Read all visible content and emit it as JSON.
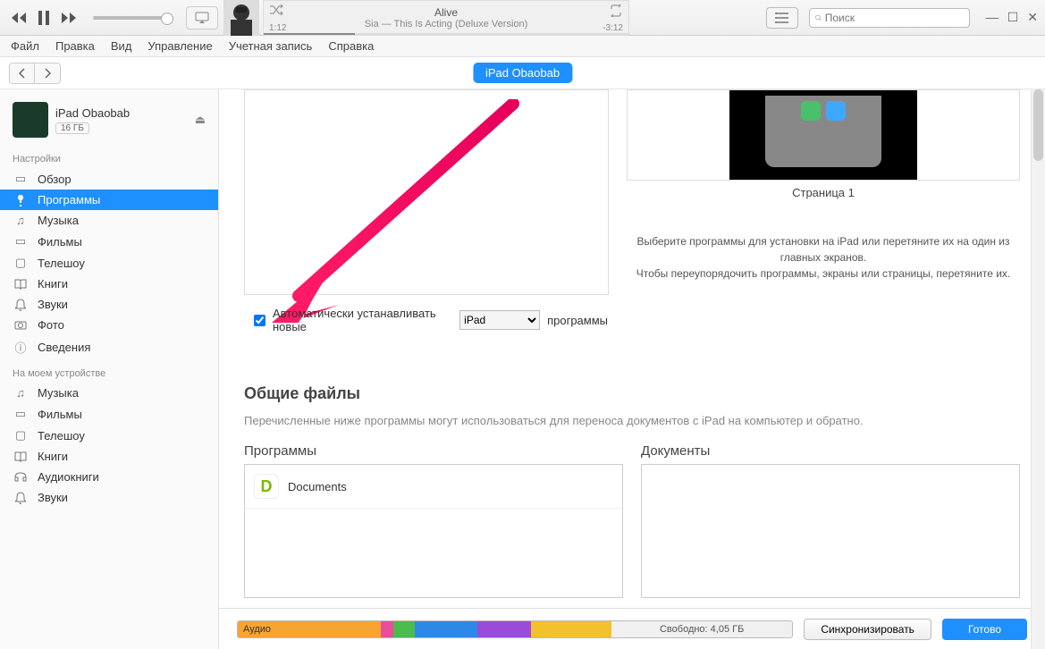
{
  "player": {
    "track_title": "Alive",
    "track_subtitle": "Sia — This Is Acting (Deluxe Version)",
    "time_elapsed": "1:12",
    "time_remaining": "-3:12"
  },
  "search": {
    "placeholder": "Поиск"
  },
  "menubar": [
    "Файл",
    "Правка",
    "Вид",
    "Управление",
    "Учетная запись",
    "Справка"
  ],
  "nav": {
    "device_pill": "iPad Obaobab"
  },
  "device": {
    "name": "iPad Obaobab",
    "capacity": "16 ГБ"
  },
  "sidebar": {
    "section1_label": "Настройки",
    "section1_items": [
      "Обзор",
      "Программы",
      "Музыка",
      "Фильмы",
      "Телешоу",
      "Книги",
      "Звуки",
      "Фото",
      "Сведения"
    ],
    "section2_label": "На моем устройстве",
    "section2_items": [
      "Музыка",
      "Фильмы",
      "Телешоу",
      "Книги",
      "Аудиокниги",
      "Звуки"
    ]
  },
  "preview": {
    "page_label": "Страница 1"
  },
  "auto_install": {
    "checkbox_label": "Автоматически устанавливать новые",
    "select_value": "iPad",
    "suffix": "программы",
    "help_line1": "Выберите программы для установки на iPad или перетяните их на один из главных экранов.",
    "help_line2": "Чтобы переупорядочить программы, экраны или страницы, перетяните их."
  },
  "shared": {
    "heading": "Общие файлы",
    "description": "Перечисленные ниже программы могут использоваться для переноса документов с iPad на компьютер и обратно.",
    "col_apps": "Программы",
    "col_docs": "Документы",
    "apps": [
      {
        "name": "Documents"
      }
    ]
  },
  "bottom": {
    "audio_label": "Аудио",
    "free_label": "Свободно: 4,05 ГБ",
    "sync_button": "Синхронизировать",
    "done_button": "Готово"
  }
}
